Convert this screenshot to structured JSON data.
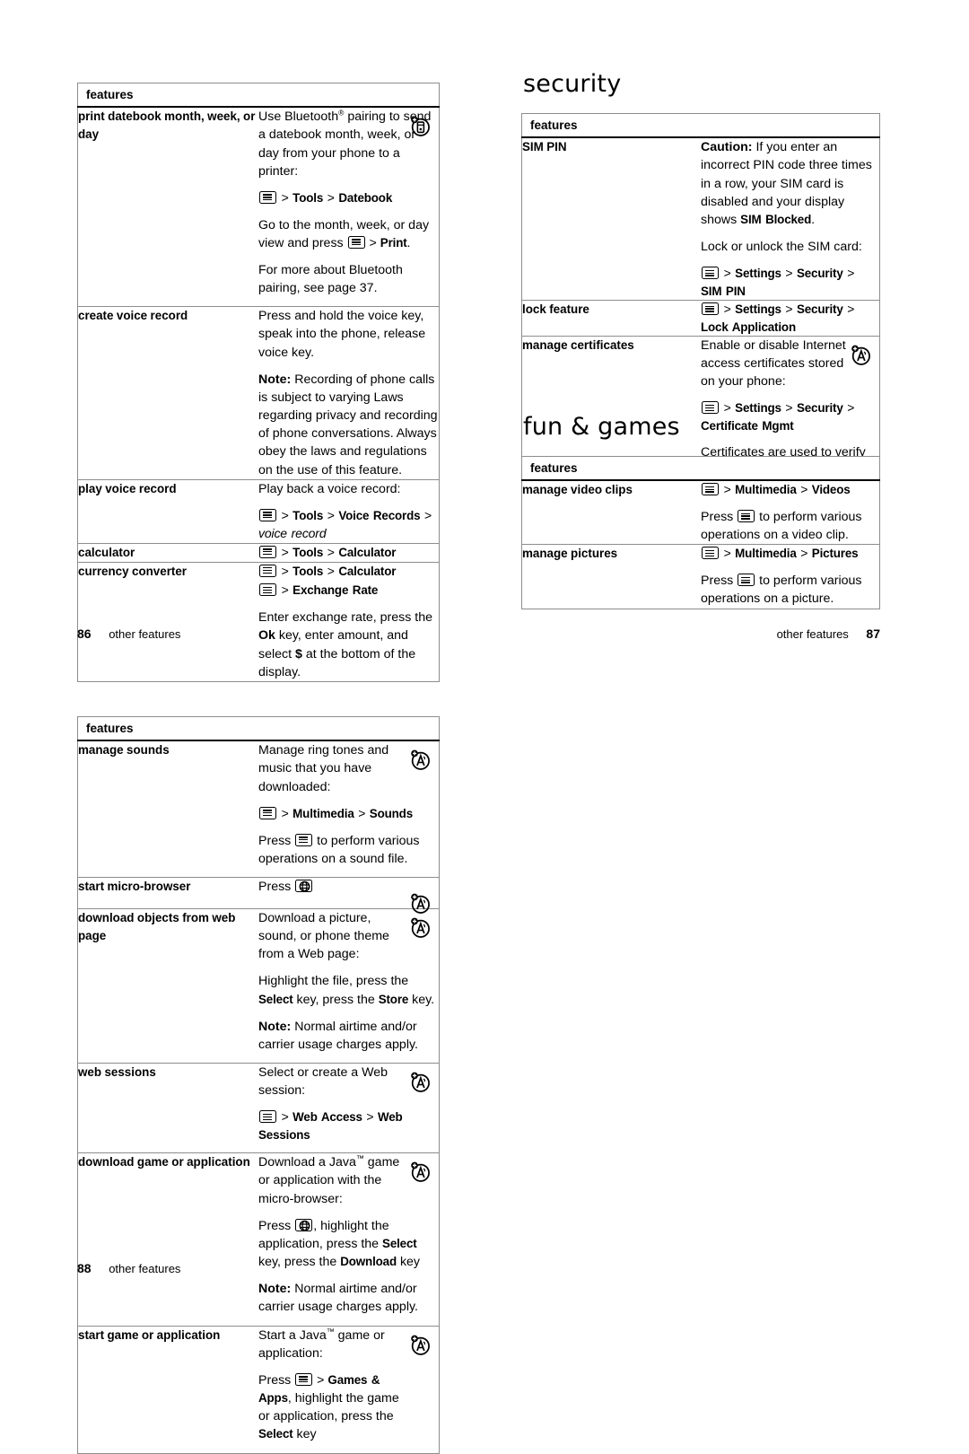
{
  "document": {
    "type": "phone-user-guide-spread",
    "footers": [
      {
        "page": "86",
        "label": "other features",
        "align": "left"
      },
      {
        "page": "87",
        "label": "other features",
        "align": "right"
      },
      {
        "page": "88",
        "label": "other features",
        "align": "left"
      }
    ]
  },
  "headings": {
    "security": "security",
    "fun_games": "fun & games"
  },
  "table_header": "features",
  "tables": {
    "other_features_86": {
      "header": "features",
      "rows": [
        {
          "key": "print datebook month, week, or day",
          "icon": "bluetooth-device-icon",
          "paras": [
            {
              "type": "text",
              "html": "Use Bluetooth<sup class=\"sup\">&reg;</sup> pairing to send a datebook month, week, or day from your phone to a printer:"
            },
            {
              "type": "cmd",
              "parts": [
                "menu-key",
                "Tools",
                "Datebook"
              ]
            },
            {
              "type": "text",
              "html": "Go to the month, week, or day view and press <span class=\"key\"></span> &gt; <b>Print</b>."
            },
            {
              "type": "text",
              "html": "For more about Bluetooth pairing, see page 37."
            }
          ]
        },
        {
          "key": "create voice record",
          "icon": null,
          "paras": [
            {
              "type": "text",
              "html": "Press and hold the voice key, speak into the phone, release voice key."
            },
            {
              "type": "text",
              "html": "<b>Note:</b> Recording of phone calls is subject to varying Laws regarding privacy and recording of phone conversations. Always obey the laws and regulations on the use of this feature."
            }
          ]
        },
        {
          "key": "play voice record",
          "icon": null,
          "paras": [
            {
              "type": "text",
              "html": "Play back a voice record:"
            },
            {
              "type": "cmd",
              "parts": [
                "menu-key",
                "Tools",
                "Voice Records",
                "voice record"
              ]
            }
          ]
        },
        {
          "key": "calculator",
          "icon": null,
          "paras": [
            {
              "type": "cmd",
              "parts": [
                "menu-key",
                "Tools",
                "Calculator"
              ]
            }
          ]
        },
        {
          "key": "currency converter",
          "icon": null,
          "paras": [
            {
              "type": "cmd",
              "parts": [
                "menu-key",
                "Tools",
                "Calculator"
              ]
            },
            {
              "type": "cmd",
              "parts": [
                "menu-key",
                "Exchange Rate"
              ]
            },
            {
              "type": "text",
              "html": "Enter exchange rate, press the <b>Ok</b> key, enter amount, and select <b>$</b> at the bottom of the display."
            }
          ]
        }
      ]
    },
    "security_87": {
      "header": "features",
      "rows": [
        {
          "key": "SIM PIN",
          "icon": null,
          "paras": [
            {
              "type": "text",
              "html": "<b>Caution:</b> If you enter an incorrect PIN code three times in a row, your SIM card is disabled and your display shows <b>SIM Blocked</b>."
            },
            {
              "type": "text",
              "html": "Lock or unlock the SIM card:"
            },
            {
              "type": "cmd",
              "parts": [
                "menu-key",
                "Settings",
                "Security",
                "SIM PIN"
              ]
            }
          ]
        },
        {
          "key": "lock feature",
          "icon": null,
          "paras": [
            {
              "type": "cmd",
              "parts": [
                "menu-key",
                "Settings",
                "Security",
                "Lock Application"
              ]
            }
          ]
        },
        {
          "key": "manage certificates",
          "icon": "network-access-icon",
          "paras": [
            {
              "type": "text",
              "html": "Enable or disable Internet access certificates stored on your phone:"
            },
            {
              "type": "cmd",
              "parts": [
                "menu-key",
                "Settings",
                "Security",
                "Certificate Mgmt"
              ]
            },
            {
              "type": "text",
              "html": "Certificates are used to verify the identity and security of Web sites when you download files or share information."
            }
          ]
        }
      ]
    },
    "fun_games_87": {
      "header": "features",
      "rows": [
        {
          "key": "manage video clips",
          "icon": null,
          "paras": [
            {
              "type": "cmd",
              "parts": [
                "menu-key",
                "Multimedia",
                "Videos"
              ]
            },
            {
              "type": "text",
              "html": "Press <span class=\"key\"></span> to perform various operations on a video clip."
            }
          ]
        },
        {
          "key": "manage pictures",
          "icon": null,
          "paras": [
            {
              "type": "cmd",
              "parts": [
                "menu-key",
                "Multimedia",
                "Pictures"
              ]
            },
            {
              "type": "text",
              "html": "Press <span class=\"key\"></span> to perform various operations on a picture."
            }
          ]
        }
      ]
    },
    "other_features_88": {
      "header": "features",
      "rows": [
        {
          "key": "manage sounds",
          "icon": "network-access-icon",
          "paras": [
            {
              "type": "text",
              "html": "Manage ring tones and music that you have downloaded:"
            },
            {
              "type": "cmd",
              "parts": [
                "menu-key",
                "Multimedia",
                "Sounds"
              ]
            },
            {
              "type": "text",
              "html": "Press <span class=\"key\"></span> to perform various operations on a sound file."
            }
          ]
        },
        {
          "key": "start micro-browser",
          "icon": "network-access-icon",
          "paras": [
            {
              "type": "text",
              "html": "Press <span class=\"globe\"></span>"
            }
          ]
        },
        {
          "key": "download objects from web page",
          "icon": "network-access-icon",
          "paras": [
            {
              "type": "text",
              "html": "Download a picture, sound, or phone theme from a Web page:"
            },
            {
              "type": "text",
              "html": "Highlight the file, press the <b>Select</b> key, press the <b>Store</b> key."
            },
            {
              "type": "text",
              "html": "<b>Note:</b> Normal airtime and/or carrier usage charges apply."
            }
          ]
        },
        {
          "key": "web sessions",
          "icon": "network-access-icon",
          "paras": [
            {
              "type": "text",
              "html": "Select or create a Web session:"
            },
            {
              "type": "cmd",
              "parts": [
                "menu-key",
                "Web Access",
                "Web Sessions"
              ]
            }
          ]
        },
        {
          "key": "download game or application",
          "icon": "network-access-icon",
          "paras": [
            {
              "type": "text",
              "html": "Download a Java<sup class=\"tm\">&trade;</sup> game or application with the micro-browser:"
            },
            {
              "type": "text",
              "html": "Press <span class=\"globe\"></span>, highlight the application, press the <b>Select</b> key, press the <b>Download</b> key"
            },
            {
              "type": "text",
              "html": "<b>Note:</b> Normal airtime and/or carrier usage charges apply."
            }
          ]
        },
        {
          "key": "start game or application",
          "icon": "network-access-icon",
          "paras": [
            {
              "type": "text",
              "html": "Start a Java<sup class=\"tm\">&trade;</sup> game or application:"
            },
            {
              "type": "text",
              "html": "Press <span class=\"key\"></span> &gt; <b>Games &amp; Apps</b>, highlight the game or application, press the <b>Select</b> key"
            }
          ]
        }
      ]
    }
  },
  "colors": {
    "text": "#000000",
    "table_border": "#8d8d8d",
    "header_rule": "#000000",
    "background": "#ffffff"
  }
}
